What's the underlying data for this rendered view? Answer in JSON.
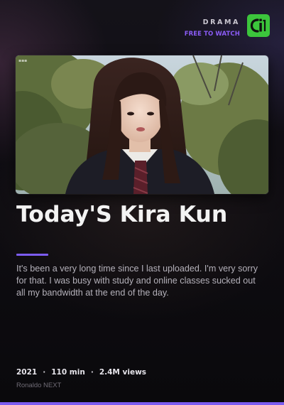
{
  "header": {
    "genre": "DRAMA",
    "availability": "FREE TO WATCH",
    "brand_logo_text": "ci"
  },
  "hero": {
    "thumbnail_icon": "video-thumbnail"
  },
  "movie": {
    "title": "Today'S Kira Kun",
    "description": "It's been a very long time since I last uploaded. I'm very sorry for that. I was busy with study and online classes sucked out all my bandwidth at the end of the day.",
    "year": "2021",
    "duration": "110 min",
    "views": "2.4M views",
    "separator": "·",
    "channel": "Ronaldo NEXT"
  },
  "colors": {
    "accent": "#7c5cf0",
    "free_label": "#8b5cf6",
    "logo_green": "#3cc53c",
    "background": "#0f0d12"
  }
}
